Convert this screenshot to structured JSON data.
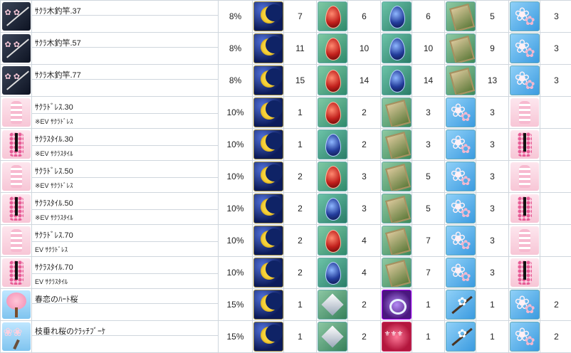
{
  "rows": [
    {
      "name": "ｻｸﾗ木釣竿.37",
      "sub": "",
      "rate": "8%",
      "icons": [
        "rod",
        "moon",
        "redgem",
        "bluegem",
        "card",
        "sakura"
      ],
      "nums": [
        "7",
        "6",
        "6",
        "5",
        "3"
      ]
    },
    {
      "name": "ｻｸﾗ木釣竿.57",
      "sub": "",
      "rate": "8%",
      "icons": [
        "rod",
        "moon",
        "redgem",
        "bluegem",
        "card",
        "sakura"
      ],
      "nums": [
        "11",
        "10",
        "10",
        "9",
        "3"
      ]
    },
    {
      "name": "ｻｸﾗ木釣竿.77",
      "sub": "",
      "rate": "8%",
      "icons": [
        "rod",
        "moon",
        "redgem",
        "bluegem",
        "card",
        "sakura"
      ],
      "nums": [
        "15",
        "14",
        "14",
        "13",
        "3"
      ]
    },
    {
      "name": "ｻｸﾗﾄﾞﾚｽ.30",
      "sub": "※EV ｻｸﾗﾄﾞﾚｽ",
      "rate": "10%",
      "icons": [
        "dress",
        "moon",
        "redgem",
        "card",
        "sakura",
        "dress"
      ],
      "nums": [
        "1",
        "2",
        "3",
        "3",
        ""
      ]
    },
    {
      "name": "ｻｸﾗｽﾀｲﾙ.30",
      "sub": "※EV ｻｸﾗｽﾀｲﾙ",
      "rate": "10%",
      "icons": [
        "style",
        "moon",
        "bluegem",
        "card",
        "sakura",
        "style"
      ],
      "nums": [
        "1",
        "2",
        "3",
        "3",
        ""
      ]
    },
    {
      "name": "ｻｸﾗﾄﾞﾚｽ.50",
      "sub": "※EV ｻｸﾗﾄﾞﾚｽ",
      "rate": "10%",
      "icons": [
        "dress",
        "moon",
        "redgem",
        "card",
        "sakura",
        "dress"
      ],
      "nums": [
        "2",
        "3",
        "5",
        "3",
        ""
      ]
    },
    {
      "name": "ｻｸﾗｽﾀｲﾙ.50",
      "sub": "※EV ｻｸﾗｽﾀｲﾙ",
      "rate": "10%",
      "icons": [
        "style",
        "moon",
        "bluegem",
        "card",
        "sakura",
        "style"
      ],
      "nums": [
        "2",
        "3",
        "5",
        "3",
        ""
      ]
    },
    {
      "name": "ｻｸﾗﾄﾞﾚｽ.70",
      "sub": "EV ｻｸﾗﾄﾞﾚｽ",
      "rate": "10%",
      "icons": [
        "dress",
        "moon",
        "redgem",
        "card",
        "sakura",
        "dress"
      ],
      "nums": [
        "2",
        "4",
        "7",
        "3",
        ""
      ]
    },
    {
      "name": "ｻｸﾗｽﾀｲﾙ.70",
      "sub": "EV ｻｸﾗｽﾀｲﾙ",
      "rate": "10%",
      "icons": [
        "style",
        "moon",
        "bluegem",
        "card",
        "sakura",
        "style"
      ],
      "nums": [
        "2",
        "4",
        "7",
        "3",
        ""
      ]
    },
    {
      "name": "春恋のﾊｰﾄ桜",
      "sub": "",
      "rate": "15%",
      "icons": [
        "tree",
        "moon",
        "diamond",
        "ring",
        "branch",
        "sakura"
      ],
      "nums": [
        "1",
        "2",
        "1",
        "1",
        "2"
      ]
    },
    {
      "name": "枝垂れ桜のｸﾗｯﾁﾌﾞｰｹ",
      "sub": "",
      "rate": "15%",
      "icons": [
        "bouquet",
        "moon",
        "diamond",
        "crest",
        "branch",
        "sakura"
      ],
      "nums": [
        "1",
        "2",
        "1",
        "1",
        "2"
      ]
    }
  ]
}
